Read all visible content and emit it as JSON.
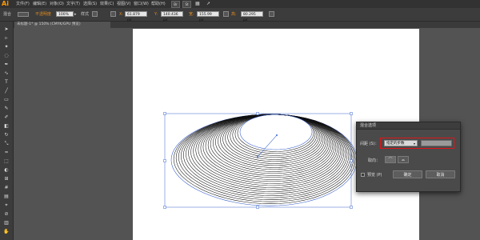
{
  "app": {
    "logo": "Ai",
    "bridge_label": "Br",
    "stock_label": "St"
  },
  "menu": [
    "文件(F)",
    "编辑(E)",
    "对象(O)",
    "文字(T)",
    "选择(S)",
    "效果(C)",
    "视图(V)",
    "窗口(W)",
    "帮助(H)"
  ],
  "controlbar": {
    "selection_label": "混合",
    "opacity_label": "不透明度",
    "opacity_value": "100%",
    "style_label": "样式",
    "x_label": "X:",
    "x_value": "61.879 px",
    "y_label": "Y:",
    "y_value": "140.436 px",
    "w_label": "宽:",
    "w_value": "155.99 px",
    "h_label": "高:",
    "h_value": "80.295 px"
  },
  "document_tab": {
    "title": "未标题-1* @ 150% (CMYK/GPU 预览)"
  },
  "dialog": {
    "title": "混合选项",
    "spacing_label": "间距 (S)：",
    "spacing_value": "指定的步数",
    "orientation_label": "取向：",
    "preview_label": "预览 (P)",
    "ok_label": "确定",
    "cancel_label": "取消"
  }
}
